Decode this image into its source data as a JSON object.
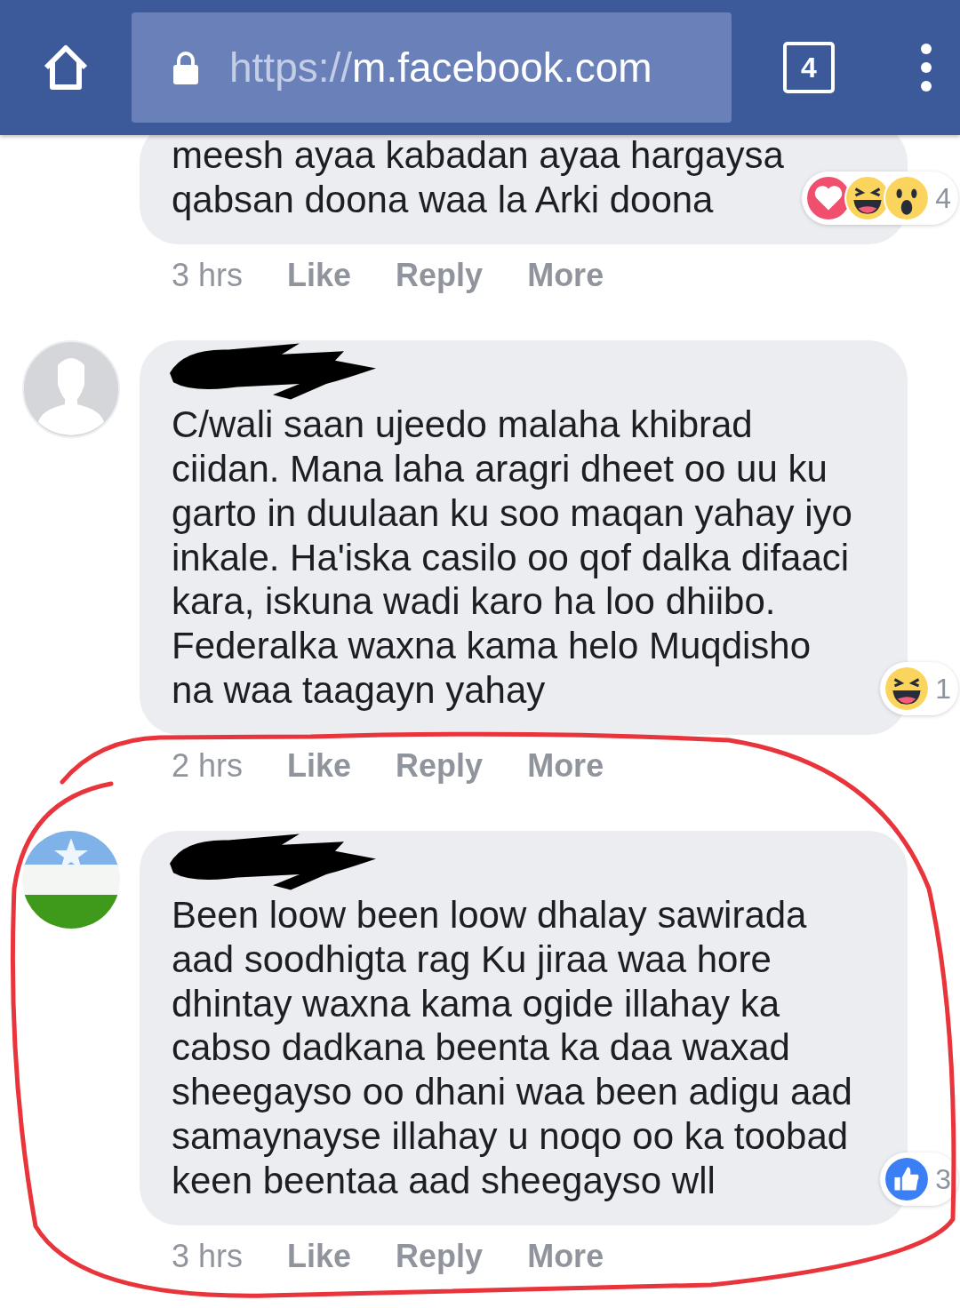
{
  "browser": {
    "url_scheme": "https://",
    "url_host": "m.facebook.com",
    "tab_count": "4"
  },
  "comments": [
    {
      "text": "meesh ayaa kabadan ayaa hargaysa\nqabsan doona waa la Arki doona",
      "reactions": [
        {
          "kind": "love"
        },
        {
          "kind": "haha"
        },
        {
          "kind": "wow"
        }
      ],
      "reaction_count": "4",
      "time": "3 hrs",
      "actions": [
        "Like",
        "Reply",
        "More"
      ]
    },
    {
      "avatar": {
        "kind": "silhouette"
      },
      "name_redacted": true,
      "text": "C/wali saan ujeedo malaha khibrad\nciidan. Mana laha aragri dheet oo uu ku\ngarto in duulaan ku soo maqan yahay iyo\ninkale. Ha'iska casilo oo qof dalka difaaci\nkara, iskuna wadi karo ha loo dhiibo.\nFederalka waxna kama helo Muqdisho\nna waa taagayn yahay",
      "reactions": [
        {
          "kind": "haha"
        }
      ],
      "reaction_count": "1",
      "time": "2 hrs",
      "actions": [
        "Like",
        "Reply",
        "More"
      ]
    },
    {
      "avatar": {
        "kind": "flag"
      },
      "name_redacted": true,
      "text": "Been loow been loow dhalay sawirada\naad soodhigta rag Ku jiraa waa hore\ndhintay waxna kama ogide illahay ka\ncabso dadkana beenta ka daa waxad\nsheegayso oo dhani waa been adigu aad\nsamaynayse illahay u noqo oo ka toobad\nkeen beentaa aad sheegayso wll",
      "reactions": [
        {
          "kind": "like"
        }
      ],
      "reaction_count": "3",
      "time": "3 hrs",
      "actions": [
        "Like",
        "Reply",
        "More"
      ]
    }
  ],
  "annotation": {
    "kind": "circle"
  }
}
